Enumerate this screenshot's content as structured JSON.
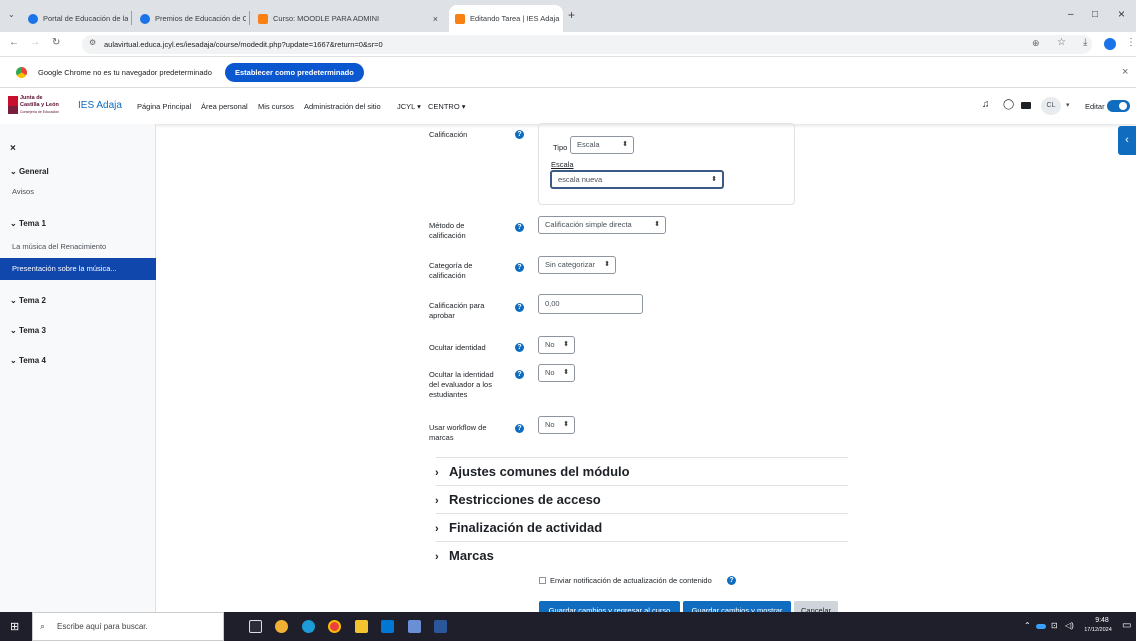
{
  "browser": {
    "tabs": [
      {
        "title": "Portal de Educación de la Junta",
        "color": "#1a73e8"
      },
      {
        "title": "Premios de Educación de Castil",
        "color": "#1a73e8"
      },
      {
        "title": "Curso: MOODLE PARA ADMINI",
        "color": "#f98012"
      },
      {
        "title": "Editando Tarea | IES Adaja",
        "color": "#f98012"
      }
    ],
    "new_tab": "+",
    "url": "aulavirtual.educa.jcyl.es/iesadaja/course/modedit.php?update=1667&return=0&sr=0",
    "infobar_text": "Google Chrome no es tu navegador predeterminado",
    "infobar_button": "Establecer como predeterminado",
    "infobar_close": "×",
    "window_controls": [
      "–",
      "□",
      "×"
    ]
  },
  "navbar": {
    "logo_line1": "Junta de",
    "logo_line2": "Castilla y León",
    "logo_line3": "Consejería de Educación",
    "site_name": "IES Adaja",
    "links": [
      "Página Principal",
      "Área personal",
      "Mis cursos",
      "Administración del sitio",
      "JCYL ▾",
      "CENTRO ▾"
    ],
    "user_initials": "CL",
    "edit_label": "Editar"
  },
  "drawer": {
    "close": "×",
    "sections": [
      {
        "title": "General",
        "items": [
          "Avisos"
        ]
      },
      {
        "title": "Tema 1",
        "items": [
          "La música del Renacimiento",
          "Presentación sobre la música..."
        ]
      },
      {
        "title": "Tema 2",
        "items": []
      },
      {
        "title": "Tema 3",
        "items": []
      },
      {
        "title": "Tema 4",
        "items": []
      }
    ]
  },
  "form": {
    "calificacion_label": "Calificación",
    "tipo_label": "Tipo",
    "tipo_value": "Escala",
    "escala_label": "Escala",
    "escala_value": "escala nueva",
    "metodo_label_1": "Método de",
    "metodo_label_2": "calificación",
    "metodo_value": "Calificación simple directa",
    "categoria_label_1": "Categoría de",
    "categoria_label_2": "calificación",
    "categoria_value": "Sin categorizar",
    "aprobar_label_1": "Calificación para",
    "aprobar_label_2": "aprobar",
    "aprobar_value": "0,00",
    "ocultar_label": "Ocultar identidad",
    "ocultar_value": "No",
    "evaluador_label_1": "Ocultar la identidad",
    "evaluador_label_2": "del evaluador a los",
    "evaluador_label_3": "estudiantes",
    "evaluador_value": "No",
    "workflow_label_1": "Usar workflow de",
    "workflow_label_2": "marcas",
    "workflow_value": "No",
    "help_glyph": "?",
    "sections": [
      "Ajustes comunes del módulo",
      "Restricciones de acceso",
      "Finalización de actividad",
      "Marcas"
    ],
    "notify_label": "Enviar notificación de actualización de contenido",
    "btn_save_return": "Guardar cambios y regresar al curso",
    "btn_save_show": "Guardar cambios y mostrar",
    "btn_cancel": "Cancelar"
  },
  "taskbar": {
    "search_placeholder": "Escribe aquí para buscar.",
    "time": "9:48",
    "date": "17/12/2024"
  },
  "colors": {
    "accent": "#0f6cbf",
    "active_item": "#0f47ad",
    "chrome_button": "#0b57d0"
  }
}
